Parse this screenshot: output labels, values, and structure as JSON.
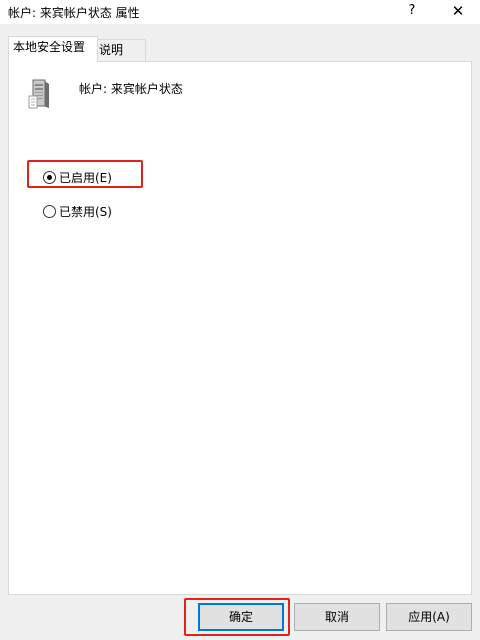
{
  "window": {
    "title": "帐户: 来宾帐户状态 属性",
    "help_label": "?",
    "close_label": "✕"
  },
  "tabs": [
    {
      "label": "本地安全设置",
      "active": true
    },
    {
      "label": "说明",
      "active": false
    }
  ],
  "policy": {
    "icon": "server-icon",
    "title": "帐户: 来宾帐户状态"
  },
  "options": [
    {
      "label": "已启用(E)",
      "checked": true
    },
    {
      "label": "已禁用(S)",
      "checked": false
    }
  ],
  "buttons": {
    "ok": "确定",
    "cancel": "取消",
    "apply": "应用(A)"
  },
  "colors": {
    "highlight": "#e0241b",
    "ok_border": "#0078d7"
  }
}
